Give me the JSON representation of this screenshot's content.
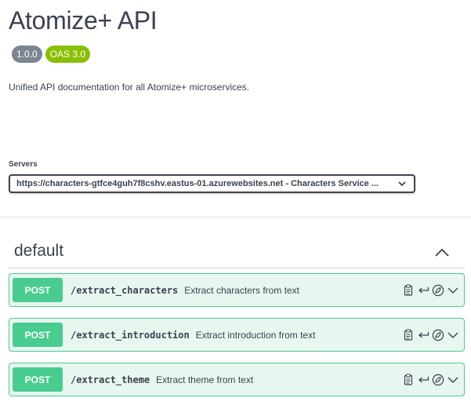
{
  "info": {
    "title": "Atomize+ API",
    "version_badge": "1.0.0",
    "oas_badge": "OAS 3.0",
    "description": "Unified API documentation for all Atomize+ microservices."
  },
  "servers": {
    "label": "Servers",
    "selected": "https://characters-gtfce4guh7f8cshv.eastus-01.azurewebsites.net - Characters Service ..."
  },
  "section": {
    "title": "default",
    "expanded": true
  },
  "operations": [
    {
      "method": "POST",
      "path": "/extract_characters",
      "summary": "Extract characters from text"
    },
    {
      "method": "POST",
      "path": "/extract_introduction",
      "summary": "Extract introduction from text"
    },
    {
      "method": "POST",
      "path": "/extract_theme",
      "summary": "Extract theme from text"
    }
  ],
  "icons": {
    "copy": "clipboard-icon",
    "return": "return-arrow-icon",
    "auth": "lock-icon",
    "expand": "chevron-down-icon",
    "collapse": "chevron-up-icon"
  },
  "colors": {
    "post_accent": "#49cc90",
    "post_background": "#e8f6f0",
    "version_badge": "#7d8492",
    "oas_badge": "#89bf04",
    "text": "#3b4151"
  }
}
